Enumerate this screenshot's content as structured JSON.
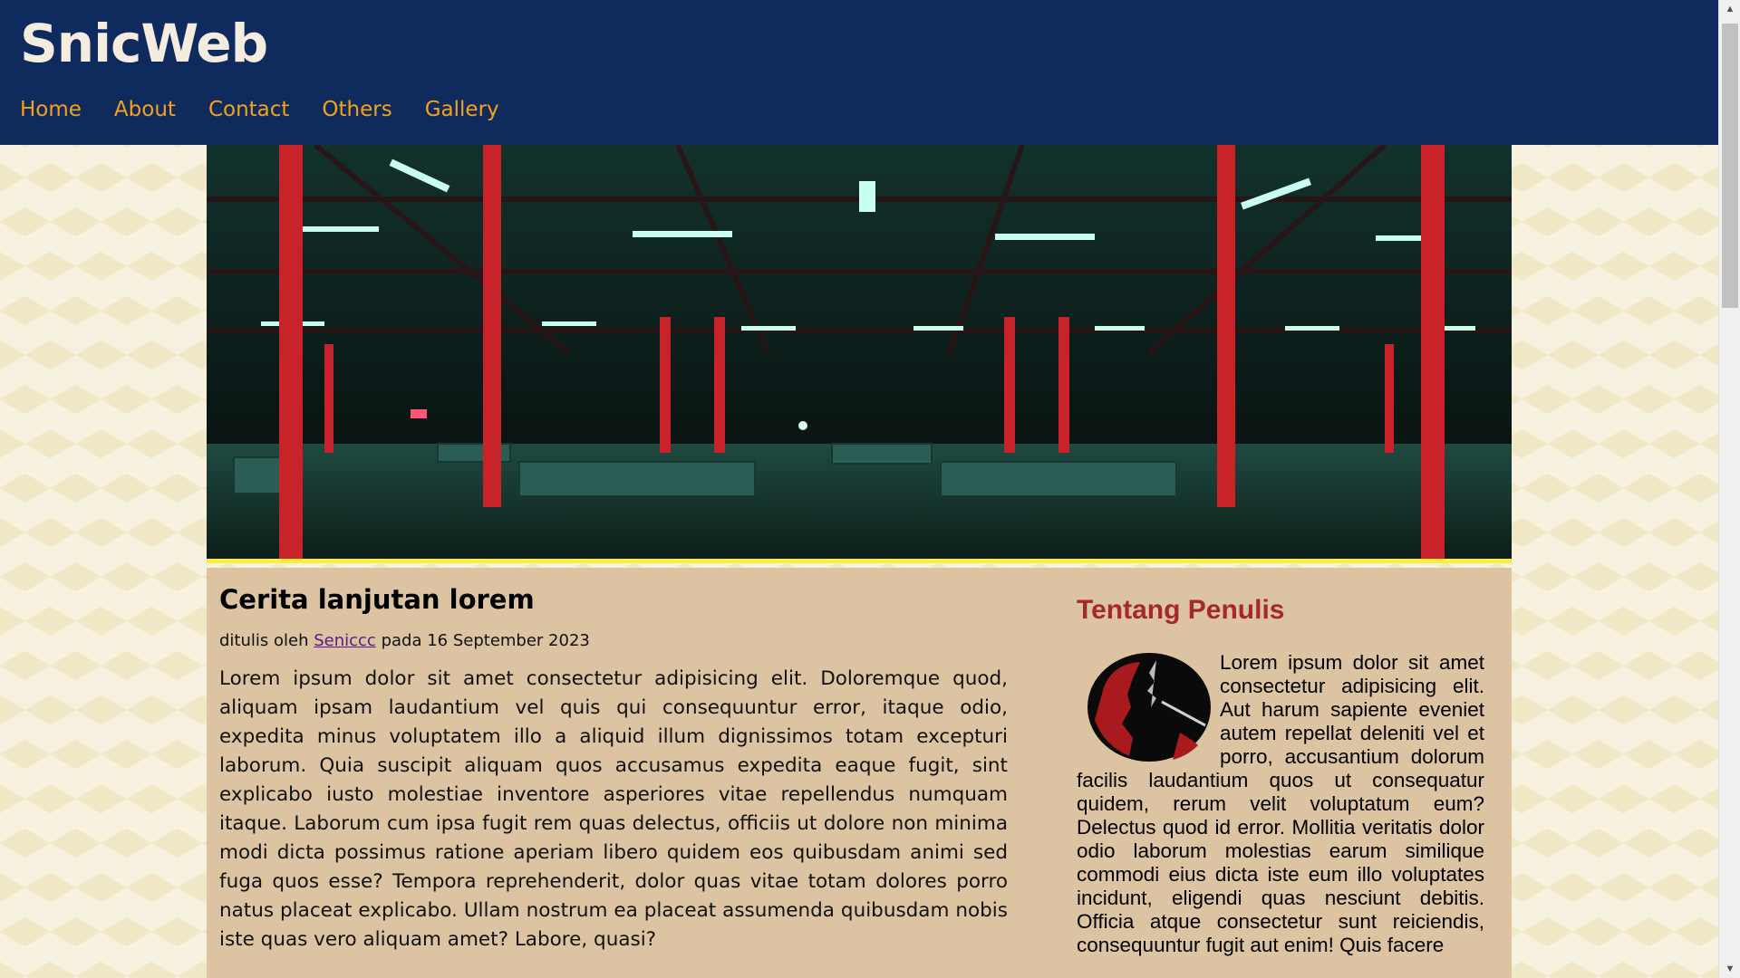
{
  "site": {
    "brand": "SnicWeb",
    "nav": [
      "Home",
      "About",
      "Contact",
      "Others",
      "Gallery"
    ]
  },
  "hero": {
    "icon": "station-photo",
    "colors": {
      "pillar": "#c8232a",
      "light": "#bfffe8",
      "border": "#fbef3c"
    }
  },
  "article": {
    "title": "Cerita lanjutan lorem",
    "byline_prefix": "ditulis oleh",
    "author": "Seniccc",
    "byline_suffix": "pada 16 September 2023",
    "body": "Lorem ipsum dolor sit amet consectetur adipisicing elit. Doloremque quod, aliquam ipsam laudantium vel quis qui consequuntur error, itaque odio, expedita minus voluptatem illo a aliquid illum dignissimos totam excepturi laborum. Quia suscipit aliquam quos accusamus expedita eaque fugit, sint explicabo iusto molestiae inventore asperiores vitae repellendus numquam itaque. Laborum cum ipsa fugit rem quas delectus, officiis ut dolore non minima modi dicta possimus ratione aperiam libero quidem eos quibusdam animi sed fuga quos esse? Tempora reprehenderit, dolor quas vitae totam dolores porro natus placeat explicabo. Ullam nostrum ea placeat assumenda quibusdam nobis iste quas vero aliquam amet? Labore, quasi?"
  },
  "sidebar": {
    "title": "Tentang Penulis",
    "body": "Lorem ipsum dolor sit amet consectetur adipisicing elit. Aut harum sapiente eveniet autem repellat deleniti vel et porro, accusantium dolorum facilis laudantium quos ut consequatur quidem, rerum velit voluptatum eum? Delectus quod id error. Mollitia veritatis dolor odio laborum molestias earum similique commodi eius dicta iste eum illo voluptates incidunt, eligendi quas nesciunt debitis. Officia atque consectetur sunt reiciendis, consequuntur fugit aut enim! Quis facere"
  },
  "colors": {
    "header_bg": "#0f2b5e",
    "nav_link": "#f3a21c",
    "content_bg": "#dcc3a1",
    "sidebar_title": "#a5292a"
  }
}
